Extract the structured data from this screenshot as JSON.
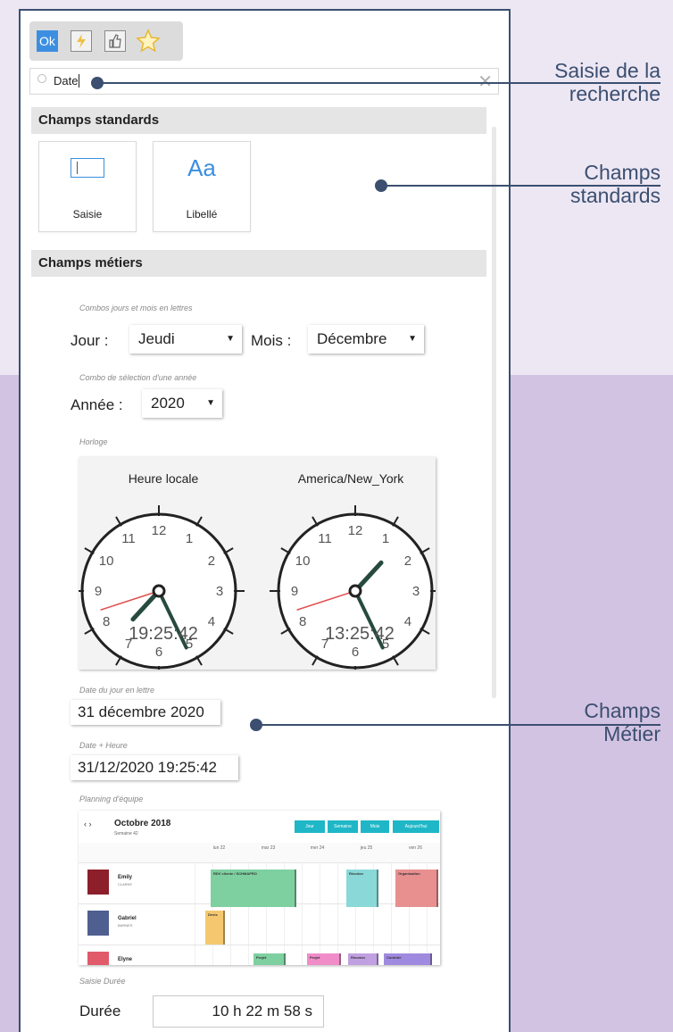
{
  "search": {
    "value": "Date"
  },
  "sections": {
    "standard": "Champs standards",
    "business": "Champs métiers"
  },
  "standard_fields": [
    {
      "label": "Saisie",
      "icon": "input-field-icon"
    },
    {
      "label": "Libellé",
      "icon_text": "Aa"
    }
  ],
  "day_month_combo": {
    "caption": "Combos jours et mois en lettres",
    "day_label": "Jour :",
    "day_value": "Jeudi",
    "month_label": "Mois :",
    "month_value": "Décembre"
  },
  "year_combo": {
    "caption": "Combo de sélection d'une année",
    "label": "Année :",
    "value": "2020"
  },
  "clock": {
    "caption": "Horloge",
    "left": {
      "title": "Heure locale",
      "time": "19:25:42"
    },
    "right": {
      "title": "America/New_York",
      "time": "13:25:42"
    },
    "numbers": [
      "12",
      "1",
      "2",
      "3",
      "4",
      "5",
      "6",
      "7",
      "8",
      "9",
      "10",
      "11"
    ]
  },
  "date_letters": {
    "caption": "Date du jour en lettre",
    "value": "31 décembre 2020"
  },
  "date_time": {
    "caption": "Date + Heure",
    "value": "31/12/2020 19:25:42"
  },
  "planning": {
    "caption": "Planning d'équipe",
    "nav": "‹  ›",
    "month": "Octobre 2018",
    "week": "Semaine 42",
    "tabs": [
      "Jour",
      "Semaine",
      "Mois",
      "Aujourd'hui"
    ],
    "days": [
      "lun 22",
      "mar 23",
      "mer 24",
      "jeu 25",
      "ven 26"
    ],
    "people": [
      {
        "name": "Emily",
        "sub": "CLARKE",
        "avatar_color": "#8c1f2a"
      },
      {
        "name": "Gabriel",
        "sub": "BARNES",
        "avatar_color": "#4f5f8f"
      },
      {
        "name": "Elyne",
        "sub": "",
        "avatar_color": "#e05a6a"
      }
    ],
    "events": [
      {
        "label": "RDV cliente / SCHMAPRO",
        "color": "#7fd0a0",
        "row": 0
      },
      {
        "label": "Réunion",
        "color": "#8ad8d8",
        "row": 0
      },
      {
        "label": "Organisation",
        "color": "#e89090",
        "row": 0
      },
      {
        "label": "Devis",
        "color": "#f5c870",
        "row": 1
      },
      {
        "label": "Projet",
        "color": "#7fd0a0",
        "row": 2
      },
      {
        "label": "Projet",
        "color": "#f08cc8",
        "row": 2
      },
      {
        "label": "Réunion",
        "color": "#c0a0e0",
        "row": 2
      },
      {
        "label": "Contrôle",
        "color": "#a08ae0",
        "row": 2
      }
    ]
  },
  "duration": {
    "caption": "Saisie Durée",
    "label": "Durée",
    "value": "10 h 22 m 58 s"
  },
  "callouts": {
    "search": [
      "Saisie de la",
      "recherche"
    ],
    "standard": [
      "Champs",
      "standards"
    ],
    "business": [
      "Champs",
      "Métier"
    ]
  },
  "colors": {
    "accent": "#3c4f70",
    "ok": "#3c8fe0",
    "planning_tab": "#1fb7c7"
  }
}
